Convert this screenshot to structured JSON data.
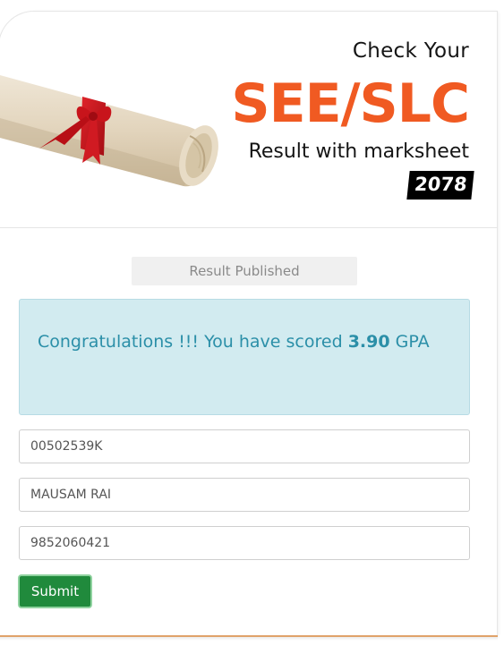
{
  "header": {
    "title_line_1": "Check Your",
    "title_main": "SEE/SLC",
    "title_sub": "Result with marksheet",
    "year": "2078"
  },
  "status": {
    "label": "Result Published"
  },
  "alert": {
    "message_prefix": "Congratulations !!! You have scored ",
    "gpa_value": "3.90",
    "message_suffix": " GPA"
  },
  "form": {
    "symbol_number": "00502539K",
    "student_name": "MAUSAM RAI",
    "phone_number": "9852060421",
    "submit_label": "Submit"
  },
  "colors": {
    "brand_orange": "#f05a22",
    "alert_background": "#d2ebf0",
    "alert_text": "#2b8fa8",
    "submit_green": "#208a3c"
  },
  "icons": {
    "header_image": "diploma-scroll-icon"
  }
}
